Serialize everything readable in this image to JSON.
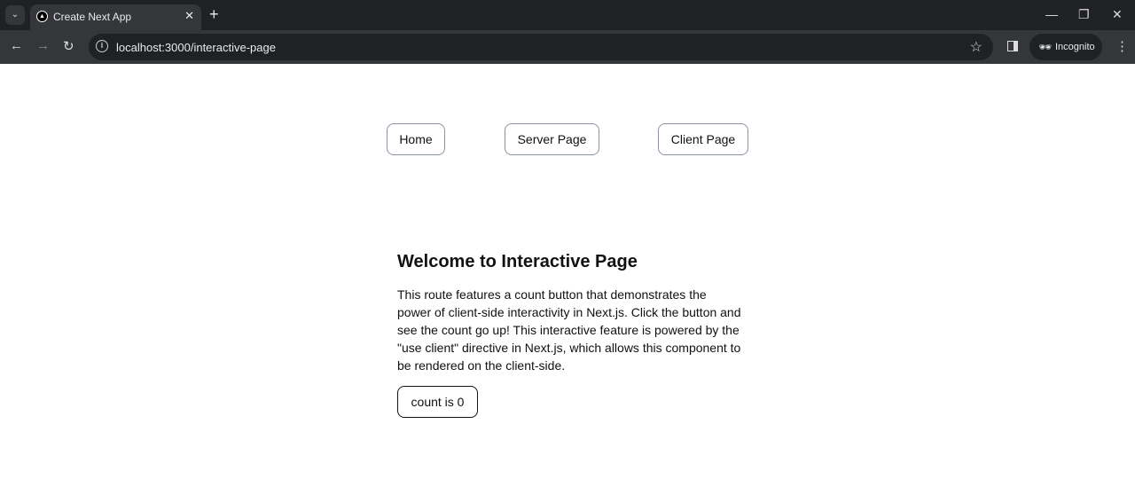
{
  "browser": {
    "tab_title": "Create Next App",
    "url": "localhost:3000/interactive-page",
    "profile": "Incognito"
  },
  "nav": {
    "home": "Home",
    "server": "Server Page",
    "client": "Client Page"
  },
  "main": {
    "title": "Welcome to Interactive Page",
    "description": "This route features a count button that demonstrates the power of client-side interactivity in Next.js. Click the button and see the count go up! This interactive feature is powered by the \"use client\" directive in Next.js, which allows this component to be rendered on the client-side.",
    "count_label": "count is 0"
  }
}
